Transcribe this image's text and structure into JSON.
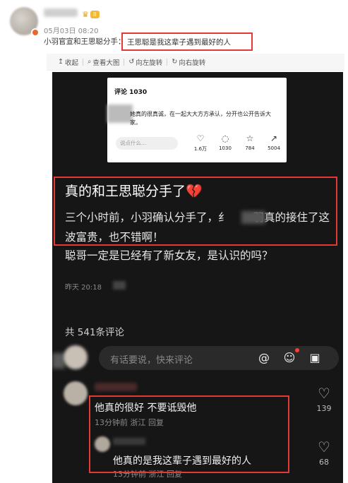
{
  "post": {
    "level": "II",
    "date": "05月03日 08:20",
    "text": "小羽官宣和王思聪分手：",
    "quote": "王思聪是我这辈子遇到最好的人"
  },
  "toolbar": {
    "collapse": "收起",
    "view_large": "查看大图",
    "rotate_left": "向左旋转",
    "rotate_right": "向右旋转"
  },
  "card": {
    "title": "评论 1030",
    "text": "她真的很真诚，在一起大大方方承认，分开也公开告诉大家。",
    "placeholder": "说点什么...",
    "stats": [
      "1.6万",
      "1030",
      "784",
      "5004"
    ]
  },
  "main": {
    "title": "真的和王思聪分手了💔",
    "body1": "三个小时前，小羽确认分手了，纟",
    "body1b": "羽真的接住了这波富贵，也不错啊！",
    "body2": "聪哥一定是已经有了新女友，是认识的吗？",
    "time": "昨天 20:18"
  },
  "comments_header": {
    "count": "共 541条评论",
    "placeholder": "有话要说，快来评论"
  },
  "comments": [
    {
      "text": "他真的很好 不要诋毁他",
      "meta": "13分钟前  浙江  回复",
      "likes": "139"
    },
    {
      "text": "他真的是我这辈子遇到最好的人",
      "meta": "13分钟前  浙江  回复",
      "likes": "68"
    }
  ]
}
